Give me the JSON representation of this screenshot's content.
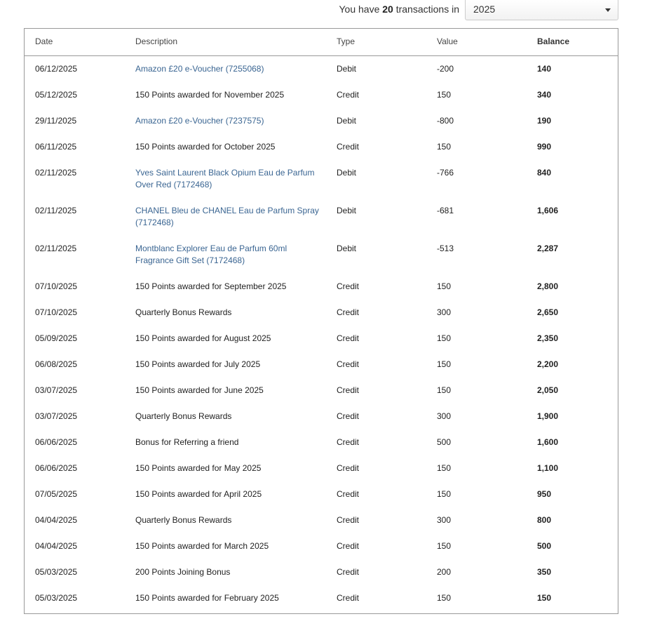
{
  "summary": {
    "prefix": "You have",
    "count": "20",
    "suffix": "transactions in"
  },
  "year_select": {
    "selected": "2025"
  },
  "table": {
    "headers": {
      "date": "Date",
      "description": "Description",
      "type": "Type",
      "value": "Value",
      "balance": "Balance"
    },
    "rows": [
      {
        "date": "06/12/2025",
        "description": "Amazon £20 e-Voucher (7255068)",
        "link": true,
        "type": "Debit",
        "value": "-200",
        "balance": "140"
      },
      {
        "date": "05/12/2025",
        "description": "150 Points awarded for November 2025",
        "link": false,
        "type": "Credit",
        "value": "150",
        "balance": "340"
      },
      {
        "date": "29/11/2025",
        "description": "Amazon £20 e-Voucher (7237575)",
        "link": true,
        "type": "Debit",
        "value": "-800",
        "balance": "190"
      },
      {
        "date": "06/11/2025",
        "description": "150 Points awarded for October 2025",
        "link": false,
        "type": "Credit",
        "value": "150",
        "balance": "990"
      },
      {
        "date": "02/11/2025",
        "description": "Yves Saint Laurent Black Opium Eau de Parfum Over Red (7172468)",
        "link": true,
        "type": "Debit",
        "value": "-766",
        "balance": "840"
      },
      {
        "date": "02/11/2025",
        "description": "CHANEL Bleu de CHANEL Eau de Parfum Spray (7172468)",
        "link": true,
        "type": "Debit",
        "value": "-681",
        "balance": "1,606"
      },
      {
        "date": "02/11/2025",
        "description": "Montblanc Explorer Eau de Parfum 60ml Fragrance Gift Set (7172468)",
        "link": true,
        "type": "Debit",
        "value": "-513",
        "balance": "2,287"
      },
      {
        "date": "07/10/2025",
        "description": "150 Points awarded for September 2025",
        "link": false,
        "type": "Credit",
        "value": "150",
        "balance": "2,800"
      },
      {
        "date": "07/10/2025",
        "description": "Quarterly Bonus Rewards",
        "link": false,
        "type": "Credit",
        "value": "300",
        "balance": "2,650"
      },
      {
        "date": "05/09/2025",
        "description": "150 Points awarded for August 2025",
        "link": false,
        "type": "Credit",
        "value": "150",
        "balance": "2,350"
      },
      {
        "date": "06/08/2025",
        "description": "150 Points awarded for July 2025",
        "link": false,
        "type": "Credit",
        "value": "150",
        "balance": "2,200"
      },
      {
        "date": "03/07/2025",
        "description": "150 Points awarded for June 2025",
        "link": false,
        "type": "Credit",
        "value": "150",
        "balance": "2,050"
      },
      {
        "date": "03/07/2025",
        "description": "Quarterly Bonus Rewards",
        "link": false,
        "type": "Credit",
        "value": "300",
        "balance": "1,900"
      },
      {
        "date": "06/06/2025",
        "description": "Bonus for Referring a friend",
        "link": false,
        "type": "Credit",
        "value": "500",
        "balance": "1,600"
      },
      {
        "date": "06/06/2025",
        "description": "150 Points awarded for May 2025",
        "link": false,
        "type": "Credit",
        "value": "150",
        "balance": "1,100"
      },
      {
        "date": "07/05/2025",
        "description": "150 Points awarded for April 2025",
        "link": false,
        "type": "Credit",
        "value": "150",
        "balance": "950"
      },
      {
        "date": "04/04/2025",
        "description": "Quarterly Bonus Rewards",
        "link": false,
        "type": "Credit",
        "value": "300",
        "balance": "800"
      },
      {
        "date": "04/04/2025",
        "description": "150 Points awarded for March 2025",
        "link": false,
        "type": "Credit",
        "value": "150",
        "balance": "500"
      },
      {
        "date": "05/03/2025",
        "description": "200 Points Joining Bonus",
        "link": false,
        "type": "Credit",
        "value": "200",
        "balance": "350"
      },
      {
        "date": "05/03/2025",
        "description": "150 Points awarded for February 2025",
        "link": false,
        "type": "Credit",
        "value": "150",
        "balance": "150"
      }
    ]
  },
  "colors": {
    "link": "#3a6592",
    "border": "#999999",
    "text": "#222222"
  }
}
